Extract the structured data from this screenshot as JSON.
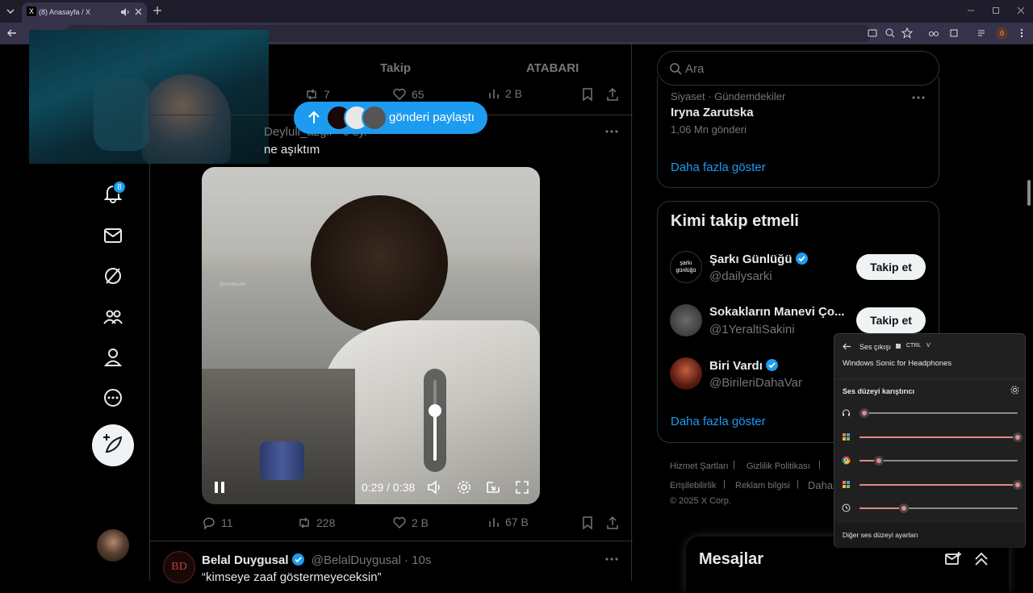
{
  "browser": {
    "tab_title": "(8) Anasayfa / X",
    "profile_letter": "ö"
  },
  "timeline_tabs": {
    "following": "Takip",
    "list": "ATABARI"
  },
  "top_tweet_actions": {
    "retweets": "7",
    "likes": "65",
    "views": "2 B"
  },
  "share_pill": {
    "label": "gönderi paylaştı"
  },
  "nav": {
    "notifications_badge": "8"
  },
  "video_tweet": {
    "author_partial": "Deyluli_azgil · 6 sy.",
    "text": "ne aşıktım",
    "video": {
      "time": "0:29 / 0:38",
      "volume_level": 0.62,
      "watermark": "@ASIMLAR"
    },
    "actions": {
      "replies": "11",
      "retweets": "228",
      "likes": "2 B",
      "views": "67 B"
    }
  },
  "next_tweet": {
    "author": "Belal Duygusal",
    "handle": "@BelalDuygusal · 10s",
    "text": "“kimseye zaaf göstermeyeceksin”"
  },
  "search": {
    "placeholder": "Ara"
  },
  "trend": {
    "category": "Siyaset · Gündemdekiler",
    "title": "Iryna Zarutska",
    "count": "1,06 Mn gönderi",
    "more": "Daha fazla göster"
  },
  "who_to_follow": {
    "title": "Kimi takip etmeli",
    "users": [
      {
        "name": "Şarkı Günlüğü",
        "handle": "@dailysarki",
        "button": "Takip et",
        "avatar_text": "şarkı günlüğü"
      },
      {
        "name": "Sokakların Manevi Ço...",
        "handle": "@1YeraltiSakini",
        "button": "Takip et"
      },
      {
        "name": "Biri Vardı",
        "handle": "@BirileriDahaVar"
      }
    ],
    "more": "Daha fazla göster"
  },
  "footer": {
    "terms": "Hizmet Şartları",
    "privacy": "Gizlilik Politikası",
    "accessibility": "Erişilebilirlik",
    "ads": "Reklam bilgisi",
    "more_partial": "Daha",
    "copyright": "© 2025 X Corp."
  },
  "messages": {
    "title": "Mesajlar"
  },
  "mixer": {
    "output_label": "Ses çıkışı",
    "shortcut": [
      "CTRL",
      "V"
    ],
    "device": "Windows Sonic for Headphones",
    "mixer_title": "Ses düzeyi karıştırıcı",
    "more_settings": "Diğer ses düzeyi ayarları",
    "apps": [
      {
        "icon": "headphones-icon",
        "level": 0.03
      },
      {
        "icon": "app-icon",
        "level": 1.0
      },
      {
        "icon": "chrome-icon",
        "level": 0.12
      },
      {
        "icon": "app-icon",
        "level": 1.0
      },
      {
        "icon": "clock-icon",
        "level": 0.28
      }
    ]
  },
  "colors": {
    "accent": "#1d9bf0",
    "background": "#000000",
    "border": "#2f3336",
    "muted": "#71767b",
    "mixer_accent": "#e28a8a"
  }
}
